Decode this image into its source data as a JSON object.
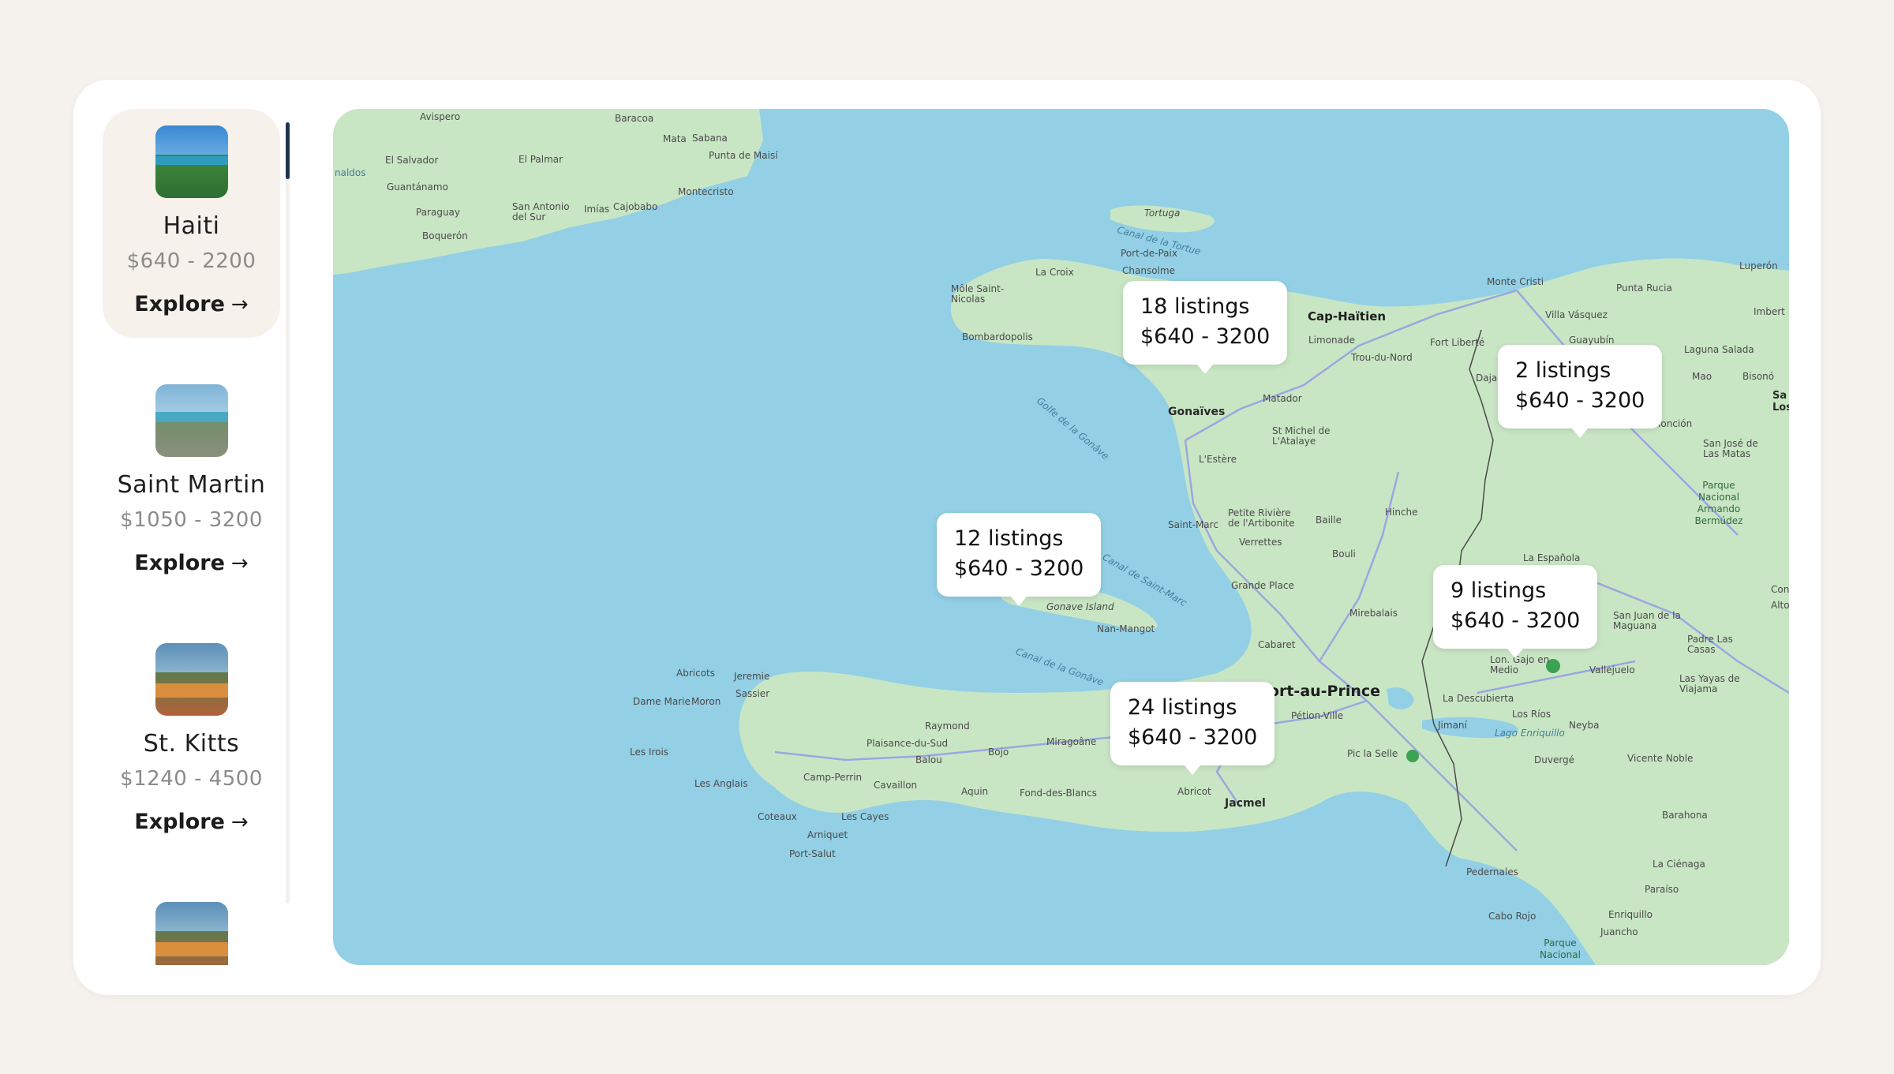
{
  "destinations": [
    {
      "name": "Haiti",
      "price": "$640 - 2200",
      "explore": "Explore"
    },
    {
      "name": "Saint Martin",
      "price": "$1050 - 3200",
      "explore": "Explore"
    },
    {
      "name": "St. Kitts",
      "price": "$1240 - 4500",
      "explore": "Explore"
    },
    {
      "name": "",
      "price": "",
      "explore": ""
    }
  ],
  "map": {
    "callouts": [
      {
        "count": "18 listings",
        "range": "$640 - 3200"
      },
      {
        "count": "2 listings",
        "range": "$640 - 3200"
      },
      {
        "count": "12 listings",
        "range": "$640 - 3200"
      },
      {
        "count": "9 listings",
        "range": "$640 - 3200"
      },
      {
        "count": "24 listings",
        "range": "$640 - 3200"
      }
    ],
    "labels": {
      "port_au_prince": "Port-au-Prince",
      "cap_haitien": "Cap-Haïtien",
      "gonaives": "Gonaïves",
      "jacmel": "Jacmel",
      "tortuga": "Tortuga",
      "canal_tortue": "Canal de la Tortue",
      "port_de_paix": "Port-de-Paix",
      "chansolme": "Chansolme",
      "la_croix": "La Croix",
      "mole": "Môle Saint-Nicolas",
      "bombardopolis": "Bombardopolis",
      "golfe": "Golfe de la Gonâve",
      "canal_st_marc": "Canal de Saint-Marc",
      "canal_gonave": "Canal de la Gonâve",
      "gonave_island": "Gonave Island",
      "nan_mangot": "Nan-Mangot",
      "lestere": "L'Estère",
      "saint_marc": "Saint-Marc",
      "petite_riviere": "Petite Rivière de l'Artibonite",
      "verrettes": "Verrettes",
      "baille": "Baille",
      "hinche": "Hinche",
      "bouli": "Bouli",
      "grande_place": "Grande Place",
      "mirebalais": "Mirebalais",
      "cabaret": "Cabaret",
      "petion_ville": "Pétion-Ville",
      "matador": "Matador",
      "st_michel": "St Michel de L'Atalaye",
      "limonade": "Limonade",
      "trou_du_nord": "Trou-du-Nord",
      "fort_liberte": "Fort Liberté",
      "dajabon": "Dajabón",
      "monte_cristi": "Monte Cristi",
      "villa_vasquez": "Villa Vásquez",
      "punta_rucia": "Punta Rucia",
      "guayubin": "Guayubín",
      "laguna_salada": "Laguna Salada",
      "mao": "Mao",
      "bisono": "Bisonó",
      "luperon": "Luperón",
      "imbert": "Imbert",
      "moncion": "Monción",
      "san_jose": "San José de Las Matas",
      "parque_bermudez": "Parque Nacional Armando Bermúdez",
      "la_espanola": "La Española",
      "san_juan": "San Juan de la Maguana",
      "padre_casas": "Padre Las Casas",
      "las_yayas": "Las Yayas de Viajama",
      "vallejuelo": "Vallejuelo",
      "la_descubierta": "La Descubierta",
      "los_rios": "Los Ríos",
      "neyba": "Neyba",
      "jimani": "Jimaní",
      "lago_enriquillo": "Lago Enriquillo",
      "duverge": "Duvergé",
      "vicente_noble": "Vicente Noble",
      "barahona": "Barahona",
      "la_cienaga": "La Ciénaga",
      "paraiso": "Paraíso",
      "enriquillo": "Enriquillo",
      "juancho": "Juancho",
      "cabo_rojo": "Cabo Rojo",
      "pedernales": "Pedernales",
      "parque_jaragua": "Parque Nacional",
      "pic_la_selle": "Pic la Selle",
      "abricot_south": "Abricot",
      "mirogoane": "Miragoâne",
      "fond_des_blancs": "Fond-des-Blancs",
      "aquin": "Aquin",
      "bojo": "Bojo",
      "raymond": "Raymond",
      "plaisance": "Plaisance-du-Sud",
      "balou": "Balou",
      "camp_perrin": "Camp-Perrin",
      "cavaillon": "Cavaillon",
      "les_cayes": "Les Cayes",
      "arniquet": "Arniquet",
      "port_salut": "Port-Salut",
      "coteaux": "Coteaux",
      "les_anglais": "Les Anglais",
      "les_irois": "Les Irois",
      "dame_marie": "Dame Marie",
      "moron": "Moron",
      "abricots": "Abricots",
      "jeremie": "Jeremie",
      "sassier": "Sassier",
      "avispero": "Avispero",
      "baracoa": "Baracoa",
      "mata": "Mata",
      "sabana": "Sabana",
      "punta_maisi": "Punta de Maisí",
      "el_salvador": "El Salvador",
      "el_palmar": "El Palmar",
      "guantanamo": "Guantánamo",
      "paraguay": "Paraguay",
      "san_antonio": "San Antonio del Sur",
      "imias": "Imías",
      "cajobabo": "Cajobabo",
      "montecristo": "Montecristo",
      "boqueron": "Boquerón",
      "naldos": "naldos",
      "lon_gajo": "Lon. Gajo en Medio",
      "con": "Con",
      "alto": "Alto",
      "sa_los": "Sa Los"
    }
  }
}
